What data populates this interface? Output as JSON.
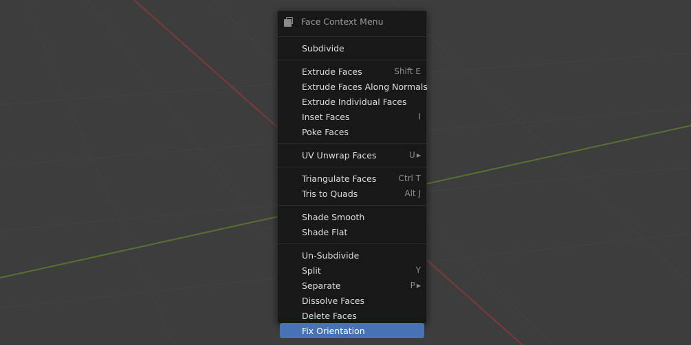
{
  "menu": {
    "title": "Face Context Menu",
    "header_icon": "face-select-icon",
    "groups": [
      [
        {
          "label": "Subdivide",
          "shortcut": "",
          "submenu": false
        }
      ],
      [
        {
          "label": "Extrude Faces",
          "shortcut": "Shift E",
          "submenu": false
        },
        {
          "label": "Extrude Faces Along Normals",
          "shortcut": "",
          "submenu": false
        },
        {
          "label": "Extrude Individual Faces",
          "shortcut": "",
          "submenu": false
        },
        {
          "label": "Inset Faces",
          "shortcut": "I",
          "submenu": false
        },
        {
          "label": "Poke Faces",
          "shortcut": "",
          "submenu": false
        }
      ],
      [
        {
          "label": "UV Unwrap Faces",
          "shortcut": "U",
          "submenu": true
        }
      ],
      [
        {
          "label": "Triangulate Faces",
          "shortcut": "Ctrl T",
          "submenu": false
        },
        {
          "label": "Tris to Quads",
          "shortcut": "Alt J",
          "submenu": false
        }
      ],
      [
        {
          "label": "Shade Smooth",
          "shortcut": "",
          "submenu": false
        },
        {
          "label": "Shade Flat",
          "shortcut": "",
          "submenu": false
        }
      ],
      [
        {
          "label": "Un-Subdivide",
          "shortcut": "",
          "submenu": false
        },
        {
          "label": "Split",
          "shortcut": "Y",
          "submenu": false
        },
        {
          "label": "Separate",
          "shortcut": "P",
          "submenu": true
        },
        {
          "label": "Dissolve Faces",
          "shortcut": "",
          "submenu": false
        },
        {
          "label": "Delete Faces",
          "shortcut": "",
          "submenu": false
        },
        {
          "label": "Fix Orientation",
          "shortcut": "",
          "submenu": false,
          "active": true
        }
      ]
    ]
  },
  "colors": {
    "viewport_bg": "#3d3d3d",
    "menu_bg": "#181818",
    "highlight": "#4772b3",
    "x_axis": "#8a3a3a",
    "y_axis": "#5d7a34"
  }
}
